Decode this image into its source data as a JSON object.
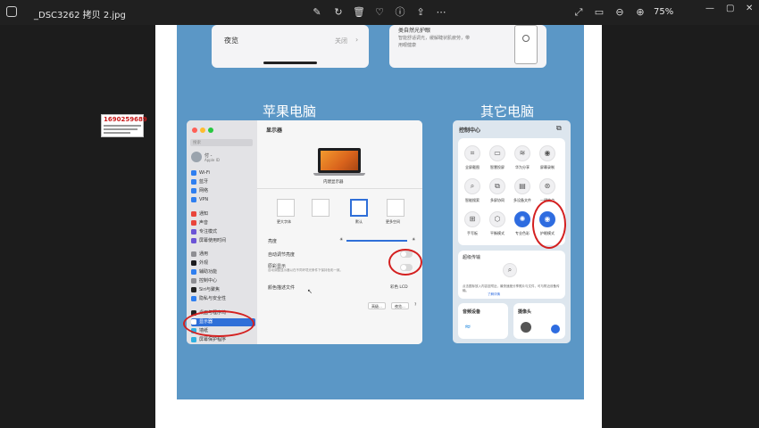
{
  "titlebar": {
    "filename": "_DSC3262 拷贝 2.jpg",
    "zoom": "75%",
    "icons": [
      "image-icon",
      "edit-icon",
      "rotate-icon",
      "delete-icon",
      "favorite-icon",
      "info-icon",
      "share-icon",
      "more-icon",
      "expand-icon",
      "fit-icon",
      "zoom-out-icon",
      "zoom-in-icon"
    ]
  },
  "top_cards": {
    "left_setting_label": "夜览",
    "left_setting_value": "关闭",
    "right_title": "类自然光护眼",
    "right_desc_1": "智能舒适调光，缓解睫状肌疲劳，带",
    "right_desc_2": "用眼健康"
  },
  "headings": {
    "apple": "苹果电脑",
    "other": "其它电脑"
  },
  "sticker": {
    "number": "1690259689",
    "line2": "飞飞一号课堂",
    "line3": "加v看视频课",
    "line4": "加微信交流"
  },
  "mac": {
    "search_placeholder": "搜索",
    "user_name": "付 -",
    "user_sub": "Apple ID",
    "sidebar": [
      "Wi-Fi",
      "蓝牙",
      "网络",
      "VPN",
      "通知",
      "声音",
      "专注模式",
      "屏幕使用时间",
      "通用",
      "外观",
      "辅助功能",
      "控制中心",
      "Siri与聚焦",
      "隐私与安全性",
      "桌面与程序坞",
      "显示器",
      "墙纸",
      "屏幕保护程序"
    ],
    "selected_item": "显示器",
    "main_title": "显示器",
    "display_name": "内建显示器",
    "modes": [
      "更大字体",
      "",
      "默认",
      "更多空间"
    ],
    "brightness_label": "亮度",
    "auto_brightness_label": "自动调节亮度",
    "truetone_label": "原彩显示",
    "truetone_desc": "自动调整显示器以在不同环境光条件下保持色彩一致。",
    "profile_label": "颜色描述文件",
    "profile_value": "彩色 LCD",
    "advanced_button": "高级...",
    "nightshift_button": "夜览...",
    "help_button": "?"
  },
  "control_center": {
    "title": "控制中心",
    "buttons": [
      "全屏截图",
      "智慧投屏",
      "华为分享",
      "屏幕录制",
      "智能搜索",
      "多屏协同",
      "多设备文件",
      "一键热点",
      "手写板",
      "平衡模式",
      "专业色彩",
      "护眼模式"
    ],
    "super_relay_title": "超级传输",
    "super_relay_desc": "点击图标放入内容至附近，最快速度分享照片与文件，可与附近设备传输。",
    "learn_more": "了解详情",
    "audio_label": "音频设备",
    "camera_label": "摄像头"
  },
  "colors": {
    "blue_bg": "#5b97c6",
    "accent": "#2e6ce0",
    "annotation": "#d42020"
  }
}
